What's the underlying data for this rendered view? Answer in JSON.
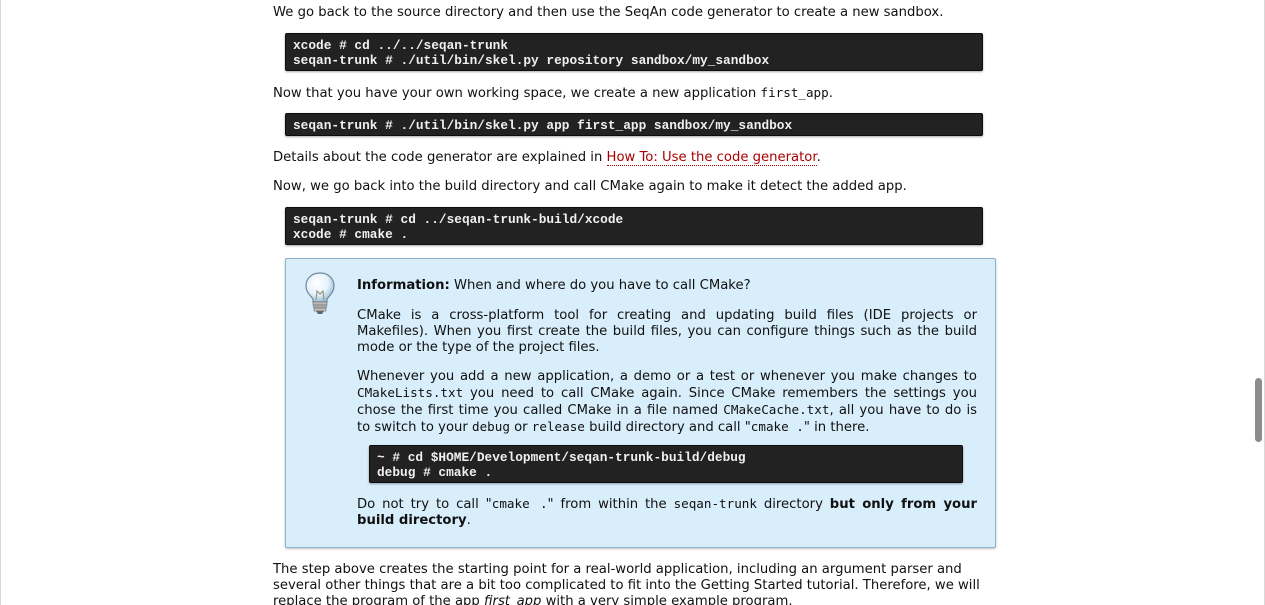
{
  "paragraphs": {
    "p1": "We go back to the source directory and then use the SeqAn code generator to create a new sandbox.",
    "p2_before": "Now that you have your own working space, we create a new application ",
    "p2_code": "first_app",
    "p2_after": ".",
    "p3_before": "Details about the code generator are explained in ",
    "p3_link": "How To: Use the code generator",
    "p3_after": ".",
    "p4": "Now, we go back into the build directory and call CMake again to make it detect the added app.",
    "p5_line1": "The step above creates the starting point for a real-world application, including an argument parser and",
    "p5_line2": "several other things that are a bit too complicated to fit into the Getting Started tutorial. Therefore, we will",
    "p5_line3_before": "replace the program of the app ",
    "p5_line3_em": "first_app",
    "p5_line3_after": " with a very simple example program."
  },
  "code_blocks": {
    "block1": [
      "xcode # cd ../../seqan-trunk",
      "seqan-trunk # ./util/bin/skel.py repository sandbox/my_sandbox"
    ],
    "block2": [
      "seqan-trunk # ./util/bin/skel.py app first_app sandbox/my_sandbox"
    ],
    "block3": [
      "seqan-trunk # cd ../seqan-trunk-build/xcode",
      "xcode # cmake ."
    ],
    "block4": [
      "~ # cd $HOME/Development/seqan-trunk-build/debug",
      "debug # cmake ."
    ]
  },
  "info_box": {
    "icon": "lightbulb-icon",
    "title_bold": "Information:",
    "title_rest": " When and where do you have to call CMake?",
    "para1": "CMake is a cross-platform tool for creating and updating build files (IDE projects or Makefiles). When you first create the build files, you can configure things such as the build mode or the type of the project files.",
    "para2_a": "Whenever you add a new application, a demo or a test or whenever you make changes to ",
    "para2_code1": "CMakeLists.txt",
    "para2_b": " you need to call CMake again. Since CMake remembers the settings you chose the first time you called CMake in a file named ",
    "para2_code2": "CMakeCache.txt",
    "para2_c": ", all you have to do is to switch to your ",
    "para2_code3": "debug",
    "para2_d": " or ",
    "para2_code4": "release",
    "para2_e": " build directory and call \"",
    "para2_code5": "cmake .",
    "para2_f": "\" in there.",
    "para3_a": "Do not try to call \"",
    "para3_code1": "cmake .",
    "para3_b": "\" from within the ",
    "para3_code2": "seqan-trunk",
    "para3_c": " directory ",
    "para3_bold": "but only from your build directory",
    "para3_d": "."
  },
  "colors": {
    "link": "#aa0000",
    "code_bg": "#222222",
    "info_bg": "#d8eefb",
    "info_border": "#8fb3cc"
  }
}
